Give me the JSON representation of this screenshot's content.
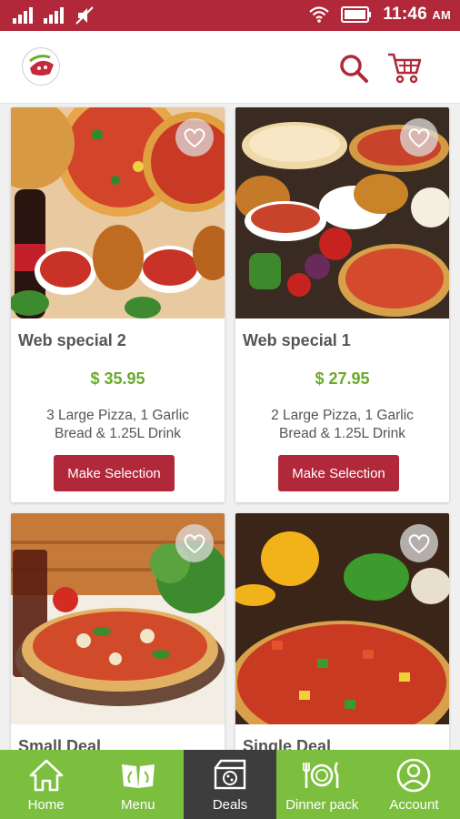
{
  "status_bar": {
    "time": "11:46",
    "ampm": "AM"
  },
  "header": {
    "logo_icon": "pizza-logo-icon",
    "search_icon": "search-icon",
    "cart_icon": "cart-icon"
  },
  "deals": [
    {
      "title": "Web special 2",
      "price": "$ 35.95",
      "desc_line1": "3 Large Pizza, 1 Garlic",
      "desc_line2": "Bread & 1.25L Drink",
      "button": "Make Selection"
    },
    {
      "title": "Web special 1",
      "price": "$ 27.95",
      "desc_line1": "2 Large Pizza, 1 Garlic",
      "desc_line2": "Bread & 1.25L Drink",
      "button": "Make Selection"
    },
    {
      "title": "Small Deal"
    },
    {
      "title": "Single Deal"
    }
  ],
  "nav": [
    {
      "label": "Home",
      "icon": "home-icon"
    },
    {
      "label": "Menu",
      "icon": "menu-book-icon"
    },
    {
      "label": "Deals",
      "icon": "pizza-box-icon",
      "active": true
    },
    {
      "label": "Dinner pack",
      "icon": "plate-cutlery-icon"
    },
    {
      "label": "Account",
      "icon": "account-icon"
    }
  ],
  "colors": {
    "brand_red": "#b0283a",
    "price_green": "#6aaa2a",
    "nav_green": "#7cbf3f",
    "nav_active": "#3d3d3d"
  }
}
